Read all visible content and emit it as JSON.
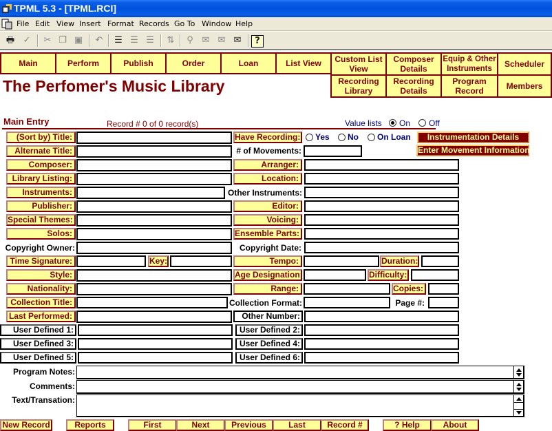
{
  "window": {
    "title": "TPML 5.3 - [TPML.RCI]"
  },
  "menu": [
    "File",
    "Edit",
    "View",
    "Insert",
    "Format",
    "Records",
    "Go To",
    "Window",
    "Help"
  ],
  "toolbar": {
    "icons": [
      "print-icon",
      "spell-check-icon",
      "cut-icon",
      "copy-icon",
      "paste-icon",
      "undo-icon",
      "new-record-icon",
      "duplicate-record-icon",
      "delete-record-icon",
      "sort-icon",
      "find-icon",
      "send-mail-icon",
      "send-icon",
      "open-url-icon",
      "help-icon"
    ]
  },
  "nav": {
    "row1": [
      "Main",
      "Perform",
      "Publish",
      "Order",
      "Loan",
      "List View",
      "Custom List View",
      "Composer Details",
      "Equip & Other Instruments",
      "Scheduler"
    ],
    "row2": [
      "Recording Library",
      "Recording Details",
      "Program Record",
      "Members"
    ]
  },
  "app_title": "The Perfomer's Music Library",
  "section": {
    "title": "Main Entry",
    "record_info": "Record # 0 of 0 record(s)",
    "value_lists": {
      "label": "Value lists",
      "options": [
        "On",
        "Off"
      ],
      "selected": "On"
    }
  },
  "have_recording": {
    "label": "Have Recording:",
    "options": [
      "Yes",
      "No",
      "On Loan"
    ],
    "selected": null
  },
  "buttons": {
    "instrumentation": "Instrumentation Details",
    "movement": "Enter Movement Information"
  },
  "fields": {
    "sort_title": {
      "label": "(Sort by) Title:",
      "value": ""
    },
    "alt_title": {
      "label": "Alternate Title:",
      "value": ""
    },
    "movements": {
      "label": "# of Movements:",
      "value": ""
    },
    "composer": {
      "label": "Composer:",
      "value": ""
    },
    "arranger": {
      "label": "Arranger:",
      "value": ""
    },
    "library_listing": {
      "label": "Library Listing:",
      "value": ""
    },
    "location": {
      "label": "Location:",
      "value": ""
    },
    "instruments": {
      "label": "Instruments:",
      "value": ""
    },
    "other_instruments": {
      "label": "Other Instruments:",
      "value": ""
    },
    "publisher": {
      "label": "Publisher:",
      "value": ""
    },
    "editor": {
      "label": "Editor:",
      "value": ""
    },
    "special_themes": {
      "label": "Special Themes:",
      "value": ""
    },
    "voicing": {
      "label": "Voicing:",
      "value": ""
    },
    "solos": {
      "label": "Solos:",
      "value": ""
    },
    "ensemble_parts": {
      "label": "Ensemble Parts:",
      "value": ""
    },
    "copyright_owner": {
      "label": "Copyright Owner:",
      "value": ""
    },
    "copyright_date": {
      "label": "Copyright Date:",
      "value": ""
    },
    "time_signature": {
      "label": "Time Signature:",
      "value": ""
    },
    "key": {
      "label": "Key:",
      "value": ""
    },
    "tempo": {
      "label": "Tempo:",
      "value": ""
    },
    "duration": {
      "label": "Duration:",
      "value": ""
    },
    "style": {
      "label": "Style:",
      "value": ""
    },
    "age_designation": {
      "label": "Age Designation:",
      "value": ""
    },
    "difficulty": {
      "label": "Difficulty:",
      "value": ""
    },
    "nationality": {
      "label": "Nationality:",
      "value": ""
    },
    "range": {
      "label": "Range:",
      "value": ""
    },
    "copies": {
      "label": "Copies:",
      "value": ""
    },
    "collection_title": {
      "label": "Collection Title:",
      "value": ""
    },
    "collection_format": {
      "label": "Collection Format:",
      "value": ""
    },
    "page": {
      "label": "Page #:",
      "value": ""
    },
    "last_performed": {
      "label": "Last Performed:",
      "value": ""
    },
    "other_number": {
      "label": "Other Number:",
      "value": ""
    },
    "ud1": {
      "label": "User Defined 1:",
      "value": ""
    },
    "ud2": {
      "label": "User Defined 2:",
      "value": ""
    },
    "ud3": {
      "label": "User Defined 3:",
      "value": ""
    },
    "ud4": {
      "label": "User Defined 4:",
      "value": ""
    },
    "ud5": {
      "label": "User Defined 5:",
      "value": ""
    },
    "ud6": {
      "label": "User Defined 6:",
      "value": ""
    },
    "program_notes": {
      "label": "Program Notes:",
      "value": ""
    },
    "comments": {
      "label": "Comments:",
      "value": ""
    },
    "text_translation": {
      "label": "Text/Transation:",
      "value": ""
    }
  },
  "bottom_buttons": [
    "New Record",
    "Reports",
    "First",
    "Next",
    "Previous",
    "Last",
    "Record #",
    "? Help",
    "About"
  ],
  "colors": {
    "accent": "#800000",
    "label_bg": "#ffff99",
    "titlebar": "#0052dc",
    "chrome": "#ece9d8"
  }
}
